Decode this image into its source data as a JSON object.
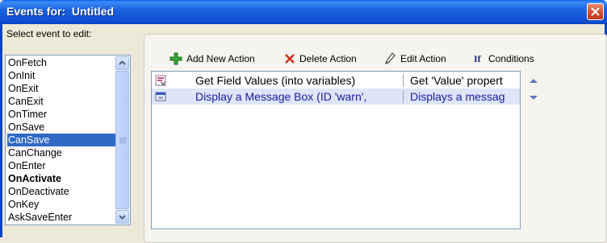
{
  "window": {
    "title": "Events for:  Untitled"
  },
  "events": {
    "label": "Select event to edit:",
    "items": [
      {
        "label": "OnFetch",
        "selected": false,
        "bold": false
      },
      {
        "label": "OnInit",
        "selected": false,
        "bold": false
      },
      {
        "label": "OnExit",
        "selected": false,
        "bold": false
      },
      {
        "label": "CanExit",
        "selected": false,
        "bold": false
      },
      {
        "label": "OnTimer",
        "selected": false,
        "bold": false
      },
      {
        "label": "OnSave",
        "selected": false,
        "bold": false
      },
      {
        "label": "CanSave",
        "selected": true,
        "bold": false
      },
      {
        "label": "CanChange",
        "selected": false,
        "bold": false
      },
      {
        "label": "OnEnter",
        "selected": false,
        "bold": false
      },
      {
        "label": "OnActivate",
        "selected": false,
        "bold": true
      },
      {
        "label": "OnDeactivate",
        "selected": false,
        "bold": false
      },
      {
        "label": "OnKey",
        "selected": false,
        "bold": false
      },
      {
        "label": "AskSaveEnter",
        "selected": false,
        "bold": false
      }
    ]
  },
  "toolbar": {
    "add_label": "Add New Action",
    "delete_label": "Delete Action",
    "edit_label": "Edit Action",
    "conditions_icon": "If",
    "conditions_label": "Conditions"
  },
  "actions": [
    {
      "name": "Get Field Values (into variables)",
      "description": "Get 'Value' propert",
      "icon": "field-values-icon",
      "selected": false
    },
    {
      "name": "Display a Message Box (ID 'warn', ",
      "description": "Displays a messag",
      "icon": "message-box-icon",
      "selected": true
    }
  ],
  "colors": {
    "title_bar": "#0c52d6",
    "selection": "#316ac5",
    "window_bg": "#ece9d8"
  }
}
